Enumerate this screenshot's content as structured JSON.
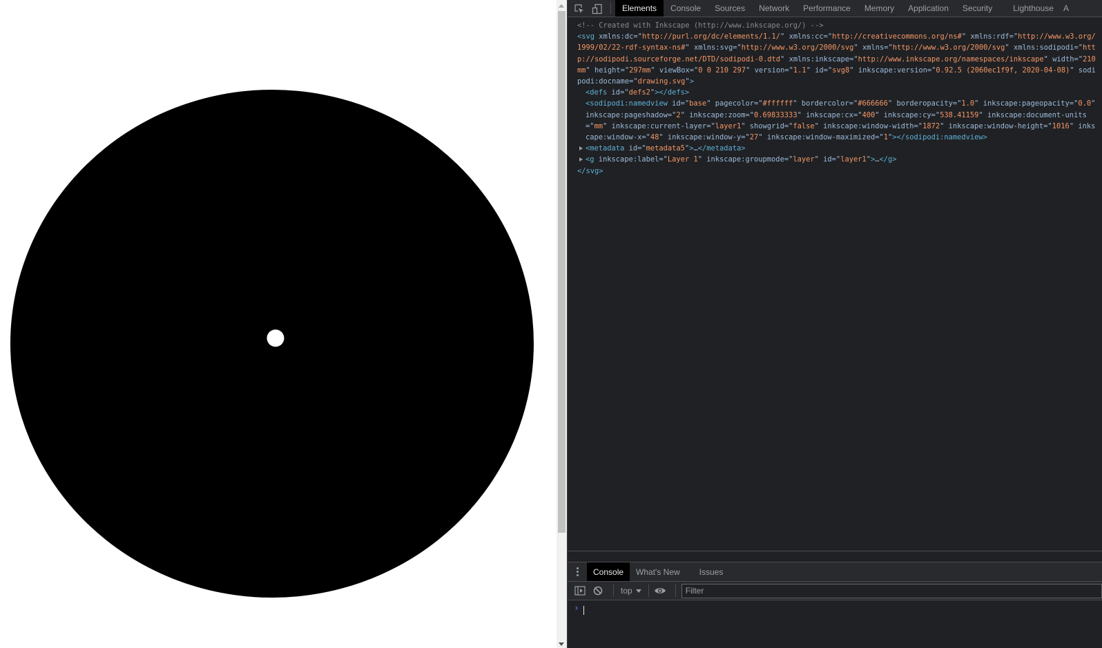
{
  "page": {
    "drawing": {
      "shape": "filled ellipse with small white dot near center",
      "fill_color": "#000000",
      "dot_color": "#ffffff",
      "background": "#ffffff"
    }
  },
  "devtools": {
    "toolbar": {
      "icons": [
        "inspect-element-icon",
        "device-toolbar-icon"
      ],
      "tabs": [
        {
          "label": "Elements",
          "active": true
        },
        {
          "label": "Console",
          "active": false
        },
        {
          "label": "Sources",
          "active": false
        },
        {
          "label": "Network",
          "active": false
        },
        {
          "label": "Performance",
          "active": false
        },
        {
          "label": "Memory",
          "active": false
        },
        {
          "label": "Application",
          "active": false
        },
        {
          "label": "Security",
          "active": false
        },
        {
          "label": "Lighthouse",
          "active": false
        },
        {
          "label": "A",
          "active": false
        }
      ]
    },
    "elements": {
      "comment": "<!-- Created with Inkscape (http://www.inkscape.org/) -->",
      "svg_open": {
        "tag": "svg",
        "attrs": [
          [
            "xmlns:dc",
            "http://purl.org/dc/elements/1.1/"
          ],
          [
            "xmlns:cc",
            "http://creativecommons.org/ns#"
          ],
          [
            "xmlns:rdf",
            "http://www.w3.org/1999/02/22-rdf-syntax-ns#"
          ],
          [
            "xmlns:svg",
            "http://www.w3.org/2000/svg"
          ],
          [
            "xmlns",
            "http://www.w3.org/2000/svg"
          ],
          [
            "xmlns:sodipodi",
            "http://sodipodi.sourceforge.net/DTD/sodipodi-0.dtd"
          ],
          [
            "xmlns:inkscape",
            "http://www.inkscape.org/namespaces/inkscape"
          ],
          [
            "width",
            "210mm"
          ],
          [
            "height",
            "297mm"
          ],
          [
            "viewBox",
            "0 0 210 297"
          ],
          [
            "version",
            "1.1"
          ],
          [
            "id",
            "svg8"
          ],
          [
            "inkscape:version",
            "0.92.5 (2060ec1f9f, 2020-04-08)"
          ],
          [
            "sodipodi:docname",
            "drawing.svg"
          ]
        ]
      },
      "defs": {
        "tag": "defs",
        "attrs": [
          [
            "id",
            "defs2"
          ]
        ],
        "close": "</defs>"
      },
      "namedview": {
        "tag": "sodipodi:namedview",
        "attrs": [
          [
            "id",
            "base"
          ],
          [
            "pagecolor",
            "#ffffff"
          ],
          [
            "bordercolor",
            "#666666"
          ],
          [
            "borderopacity",
            "1.0"
          ],
          [
            "inkscape:pageopacity",
            "0.0"
          ],
          [
            "inkscape:pageshadow",
            "2"
          ],
          [
            "inkscape:zoom",
            "0.69833333"
          ],
          [
            "inkscape:cx",
            "400"
          ],
          [
            "inkscape:cy",
            "538.41159"
          ],
          [
            "inkscape:document-units",
            "mm"
          ],
          [
            "inkscape:current-layer",
            "layer1"
          ],
          [
            "showgrid",
            "false"
          ],
          [
            "inkscape:window-width",
            "1872"
          ],
          [
            "inkscape:window-height",
            "1016"
          ],
          [
            "inkscape:window-x",
            "48"
          ],
          [
            "inkscape:window-y",
            "27"
          ],
          [
            "inkscape:window-maximized",
            "1"
          ]
        ],
        "close": "</sodipodi:namedview>"
      },
      "metadata": {
        "tag": "metadata",
        "attrs": [
          [
            "id",
            "metadata5"
          ]
        ],
        "ellipsis": "…",
        "close": "</metadata>"
      },
      "layer": {
        "tag": "g",
        "attrs": [
          [
            "inkscape:label",
            "Layer 1"
          ],
          [
            "inkscape:groupmode",
            "layer"
          ],
          [
            "id",
            "layer1"
          ]
        ],
        "ellipsis": "…",
        "close": "</g>"
      },
      "svg_close": "</svg>"
    },
    "drawer": {
      "tabs": [
        {
          "label": "Console",
          "active": true
        },
        {
          "label": "What's New",
          "active": false
        },
        {
          "label": "Issues",
          "active": false
        }
      ],
      "context": "top",
      "filter_placeholder": "Filter",
      "prompt": "›"
    }
  }
}
